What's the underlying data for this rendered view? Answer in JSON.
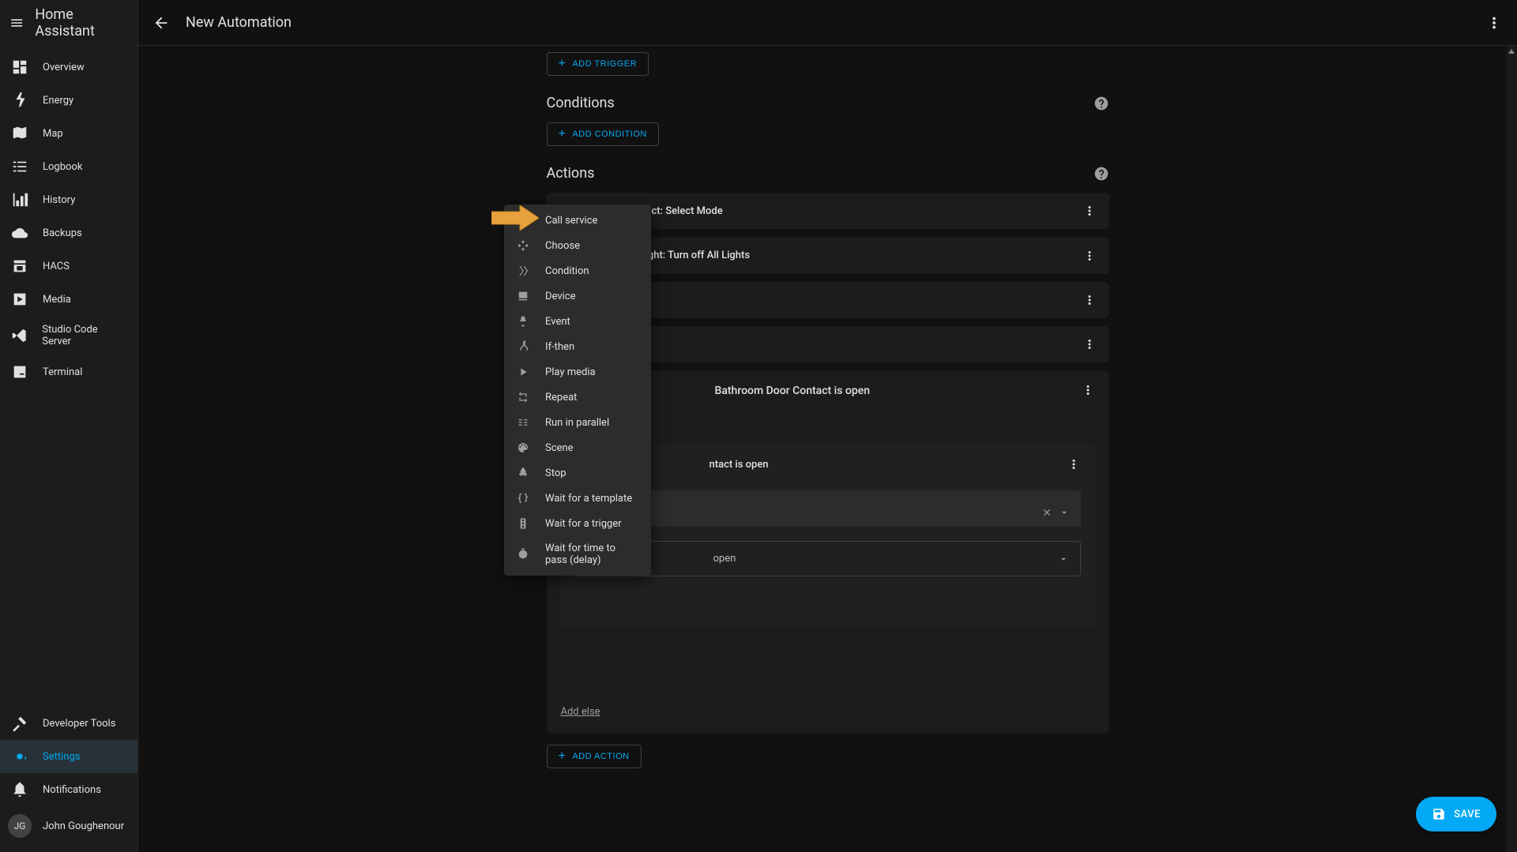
{
  "app": {
    "title": "Home Assistant",
    "page_title": "New Automation"
  },
  "sidebar": {
    "items": [
      {
        "label": "Overview"
      },
      {
        "label": "Energy"
      },
      {
        "label": "Map"
      },
      {
        "label": "Logbook"
      },
      {
        "label": "History"
      },
      {
        "label": "Backups"
      },
      {
        "label": "HACS"
      },
      {
        "label": "Media"
      },
      {
        "label": "Studio Code Server"
      },
      {
        "label": "Terminal"
      }
    ],
    "bottom": {
      "dev_tools": "Developer Tools",
      "settings": "Settings",
      "notifications": "Notifications",
      "user_initials": "JG",
      "user_name": "John Goughenour"
    }
  },
  "buttons": {
    "add_trigger": "ADD TRIGGER",
    "add_condition": "ADD CONDITION",
    "add_action": "ADD ACTION",
    "save": "SAVE",
    "add_else": "Add else"
  },
  "sections": {
    "conditions": "Conditions",
    "actions": "Actions"
  },
  "actions": [
    {
      "title": "Input select: Select Mode"
    },
    {
      "title": "Light: Turn off All Lights"
    }
  ],
  "partial_action_text": "Bathroom Door Contact is open",
  "nested": {
    "title": "ntact is open",
    "detail": "open"
  },
  "dropdown": {
    "items": [
      {
        "label": "Call service"
      },
      {
        "label": "Choose"
      },
      {
        "label": "Condition"
      },
      {
        "label": "Device"
      },
      {
        "label": "Event"
      },
      {
        "label": "If-then"
      },
      {
        "label": "Play media"
      },
      {
        "label": "Repeat"
      },
      {
        "label": "Run in parallel"
      },
      {
        "label": "Scene"
      },
      {
        "label": "Stop"
      },
      {
        "label": "Wait for a template"
      },
      {
        "label": "Wait for a trigger"
      },
      {
        "label": "Wait for time to pass (delay)"
      }
    ]
  }
}
